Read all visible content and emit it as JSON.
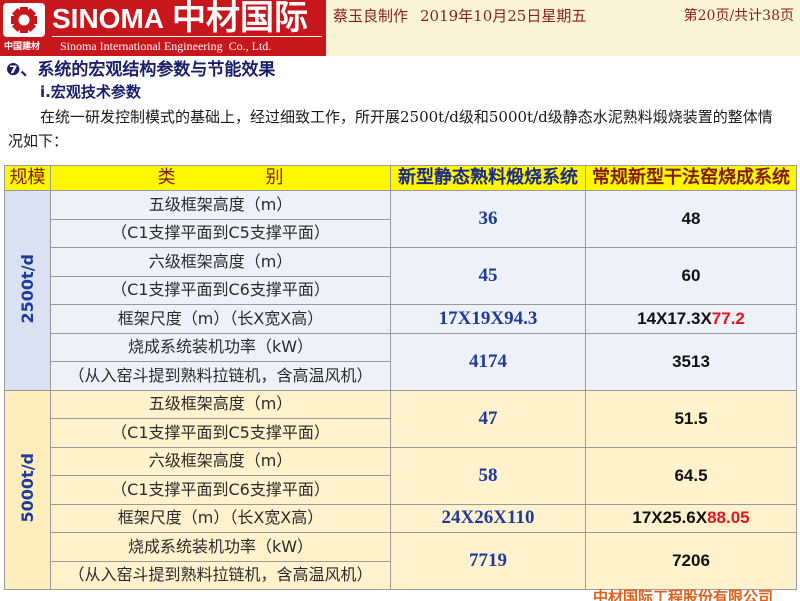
{
  "theme": {
    "brand-red": "#c8161d",
    "meta-bg": "#fbf5d7",
    "meta-text": "#8a1c1c",
    "title": "#1b1f6b",
    "thead-bg": "#fff700",
    "thead-maroon": "#7f1d12",
    "thead-navy": "#1c2a8c",
    "g1-scale-bg": "#d9e1f2",
    "g1-bg": "#eef1f8",
    "g2-scale-bg": "#ffeebb",
    "g2-bg": "#fff2cc",
    "value-blue": "#1f3a9e",
    "highlight-red": "#e5141b",
    "footer": "#e0601c"
  },
  "header": {
    "logo_icon": "sinoma-logo-icon",
    "logo_text_en": "SINOMA",
    "logo_text_cn": "中材国际",
    "company_en": "Sinoma International Engineering  Co., Ltd.",
    "badge": "中国建材",
    "author": "蔡玉良制作",
    "date": "2019年10月25日星期五",
    "page_info": "第20页/共计38页"
  },
  "content": {
    "section_title": "❼、系统的宏观结构参数与节能效果",
    "subsection_title": "ⅰ.宏观技术参数",
    "paragraph_lines": [
      "在统一研发控制模式的基础上，经过细致工作，所开展2500t/d级和5000t/d级静态水泥熟料煅烧装置的整体情",
      "况如下："
    ]
  },
  "table": {
    "headers": [
      "规模",
      "类　　　　　别",
      "新型静态熟料煅烧系统",
      "常规新型干法窑烧成系统"
    ],
    "groups": [
      {
        "scale": "2500t/d",
        "items": [
          {
            "label": [
              "五级框架高度（m）",
              "（C1支撑平面到C5支撑平面）"
            ],
            "new_system": "36",
            "conventional": "48"
          },
          {
            "label": [
              "六级框架高度（m）",
              "（C1支撑平面到C6支撑平面）"
            ],
            "new_system": "45",
            "conventional": "60"
          },
          {
            "label": [
              "框架尺度（m）（长X宽X高）"
            ],
            "new_system": "17X19X94.3",
            "conventional": "14X17.3X",
            "conventional_highlight": "77.2"
          },
          {
            "label": [
              "烧成系统装机功率（kW）",
              "（从入窑斗提到熟料拉链机，含高温风机）"
            ],
            "new_system": "4174",
            "conventional": "3513"
          }
        ]
      },
      {
        "scale": "5000t/d",
        "items": [
          {
            "label": [
              "五级框架高度（m）",
              "（C1支撑平面到C5支撑平面）"
            ],
            "new_system": "47",
            "conventional": "51.5"
          },
          {
            "label": [
              "六级框架高度（m）",
              "（C1支撑平面到C6支撑平面）"
            ],
            "new_system": "58",
            "conventional": "64.5"
          },
          {
            "label": [
              "框架尺度（m）（长X宽X高）"
            ],
            "new_system": "24X26X110",
            "conventional": "17X25.6X",
            "conventional_highlight": "88.05"
          },
          {
            "label": [
              "烧成系统装机功率（kW）",
              "（从入窑斗提到熟料拉链机，含高温风机）"
            ],
            "new_system": "7719",
            "conventional": "7206"
          }
        ]
      }
    ]
  },
  "footer": {
    "company": "中材国际工程股份有限公司"
  }
}
